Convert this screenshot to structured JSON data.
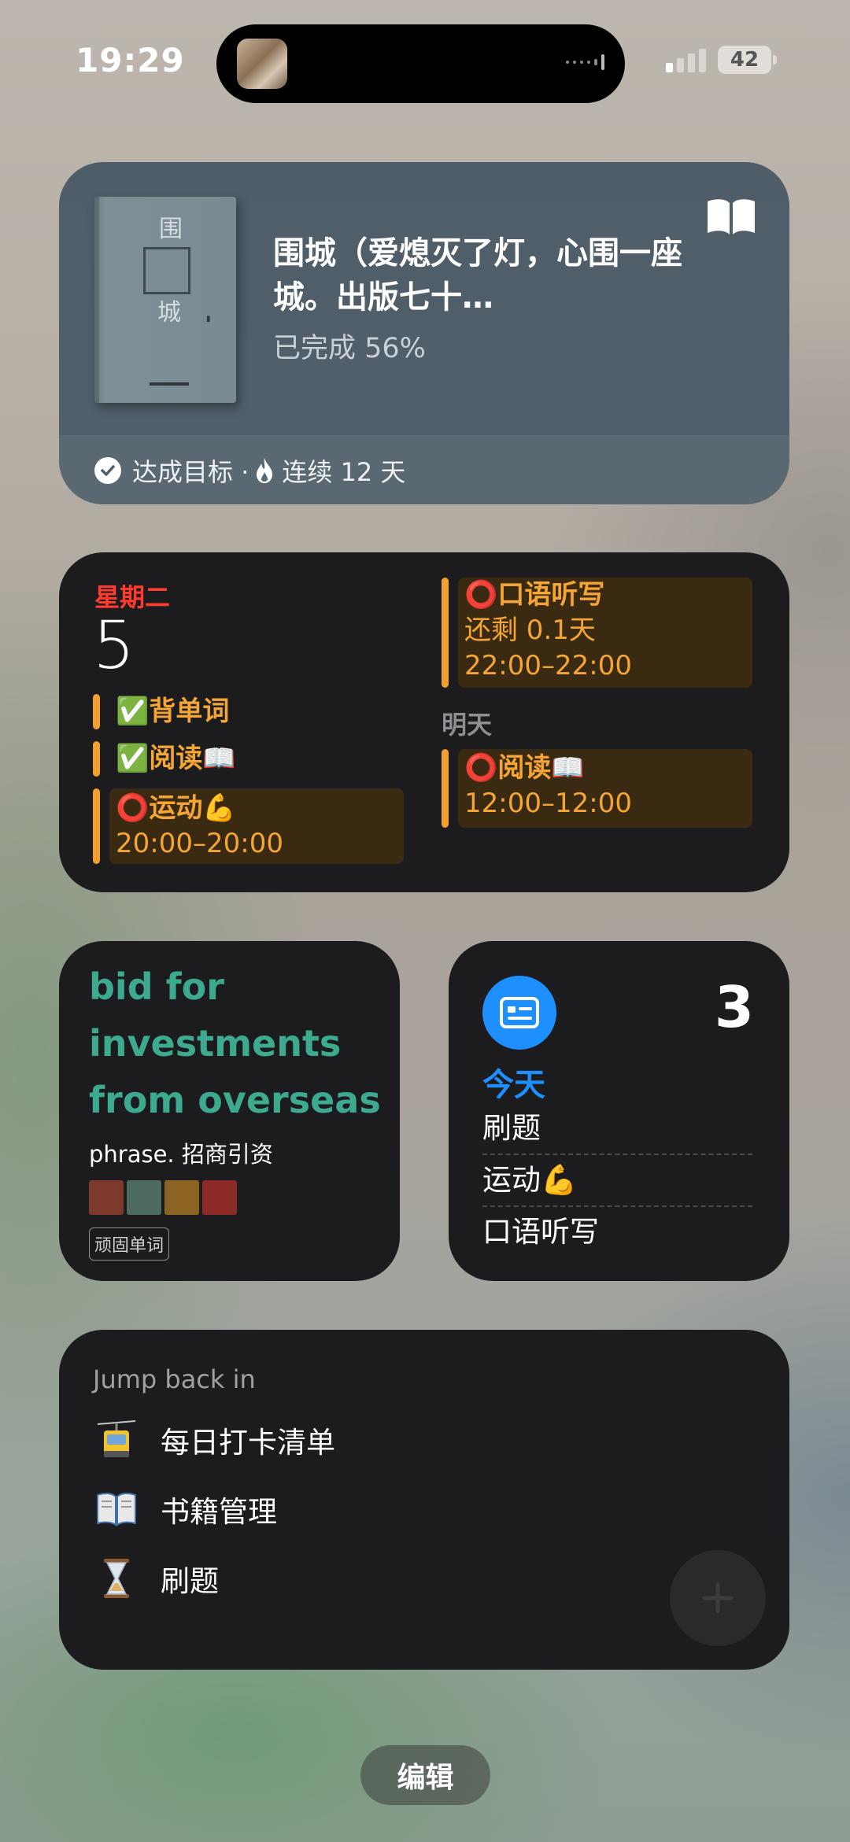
{
  "status_bar": {
    "time": "19:29",
    "battery": "42"
  },
  "book_widget": {
    "cover_chars": [
      "围",
      "城"
    ],
    "title": "围城（爱熄灭了灯，心围一座城。出版七十…",
    "progress": "已完成 56%",
    "progress_value": 0.56,
    "goal_text": "达成目标 ·",
    "streak_text": "连续 12 天"
  },
  "calendar_widget": {
    "weekday": "星期二",
    "day": "5",
    "today_events": [
      {
        "title": "✅背单词",
        "time": ""
      },
      {
        "title": "✅阅读📖",
        "time": ""
      },
      {
        "title": "⭕运动💪",
        "time": "20:00–20:00"
      }
    ],
    "top_event": {
      "title": "⭕口语听写",
      "remaining": "还剩 0.1天",
      "time": "22:00–22:00"
    },
    "tomorrow_label": "明天",
    "tomorrow_event": {
      "title": "⭕阅读📖",
      "time": "12:00–12:00"
    },
    "accent_color": "#f0a030"
  },
  "vocab_widget": {
    "word": "bid for investments from overseas",
    "definition": "phrase. 招商引资",
    "swatches": [
      "#7d3a2c",
      "#4e6b62",
      "#8a6420",
      "#8b2a26"
    ],
    "tag": "顽固单词"
  },
  "reminders_widget": {
    "count": "3",
    "list_label": "今天",
    "items": [
      "刷题",
      "运动💪",
      "口语听写"
    ]
  },
  "notion_widget": {
    "heading": "Jump back in",
    "items": [
      {
        "icon": "cable-car-icon",
        "label": "每日打卡清单"
      },
      {
        "icon": "book-icon",
        "label": "书籍管理"
      },
      {
        "icon": "hourglass-icon",
        "label": "刷题"
      }
    ]
  },
  "edit_button": "编辑"
}
